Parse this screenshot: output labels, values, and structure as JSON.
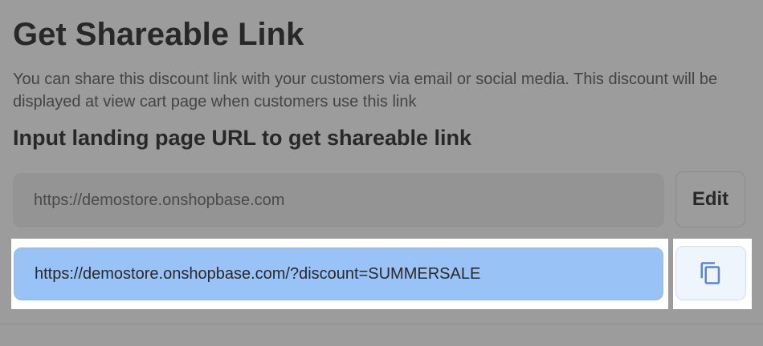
{
  "header": {
    "title": "Get Shareable Link",
    "description": "You can share this discount link with your customers via email or social media. This discount will be displayed at view cart page when customers use this link"
  },
  "landing": {
    "heading": "Input landing page URL to get shareable link",
    "url": "https://demostore.onshopbase.com",
    "edit_label": "Edit"
  },
  "shareable": {
    "link": "https://demostore.onshopbase.com/?discount=SUMMERSALE",
    "copy_icon": "copy-icon"
  },
  "colors": {
    "link_field": "#99c2f6",
    "copy_icon": "#5b86cf",
    "overlay": "#9c9c9c"
  }
}
